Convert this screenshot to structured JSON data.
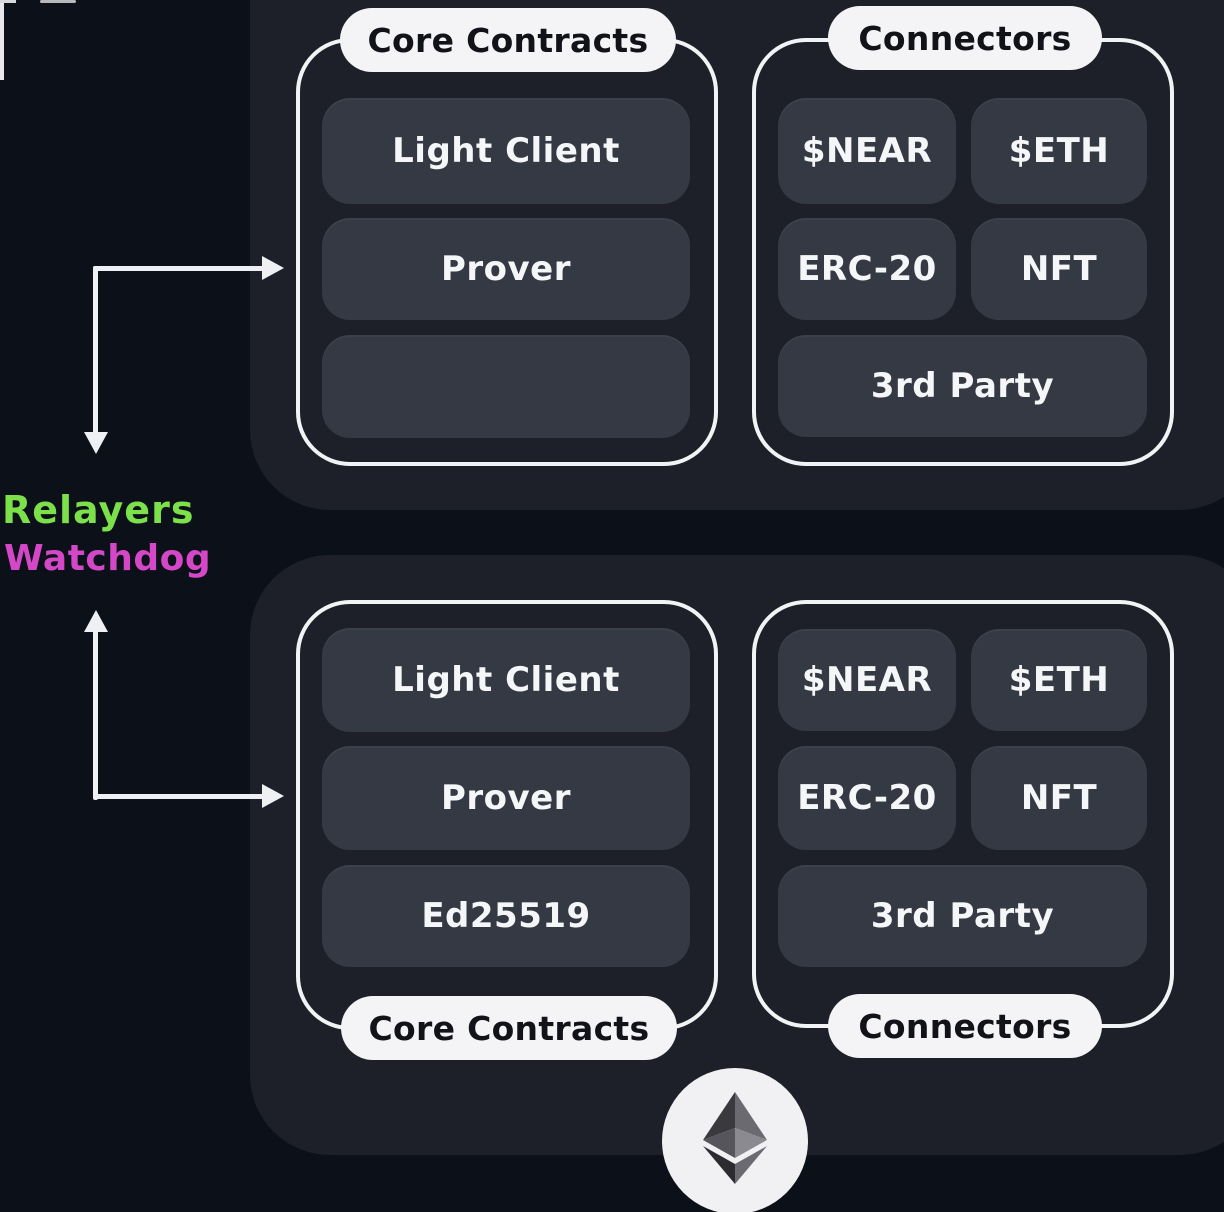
{
  "diagram": {
    "colors": {
      "background": "#0c1018",
      "panel": "#1d2028",
      "tile": "#353944",
      "frame_line": "#f2f3f5",
      "pill": "#f4f4f6",
      "relayers": "#7be04a",
      "watchdog": "#d448c8"
    },
    "side_labels": {
      "relayers": "Relayers",
      "watchdog": "Watchdog"
    },
    "top_chain": {
      "core_contracts": {
        "label": "Core Contracts",
        "items": [
          "Light Client",
          "Prover",
          ""
        ]
      },
      "connectors": {
        "label": "Connectors",
        "items": [
          "$NEAR",
          "$ETH",
          "ERC-20",
          "NFT",
          "3rd Party"
        ]
      }
    },
    "bottom_chain": {
      "core_contracts": {
        "label": "Core Contracts",
        "items": [
          "Light Client",
          "Prover",
          "Ed25519"
        ]
      },
      "connectors": {
        "label": "Connectors",
        "items": [
          "$NEAR",
          "$ETH",
          "ERC-20",
          "NFT",
          "3rd Party"
        ]
      },
      "chain_icon": "ethereum-logo-icon"
    }
  }
}
